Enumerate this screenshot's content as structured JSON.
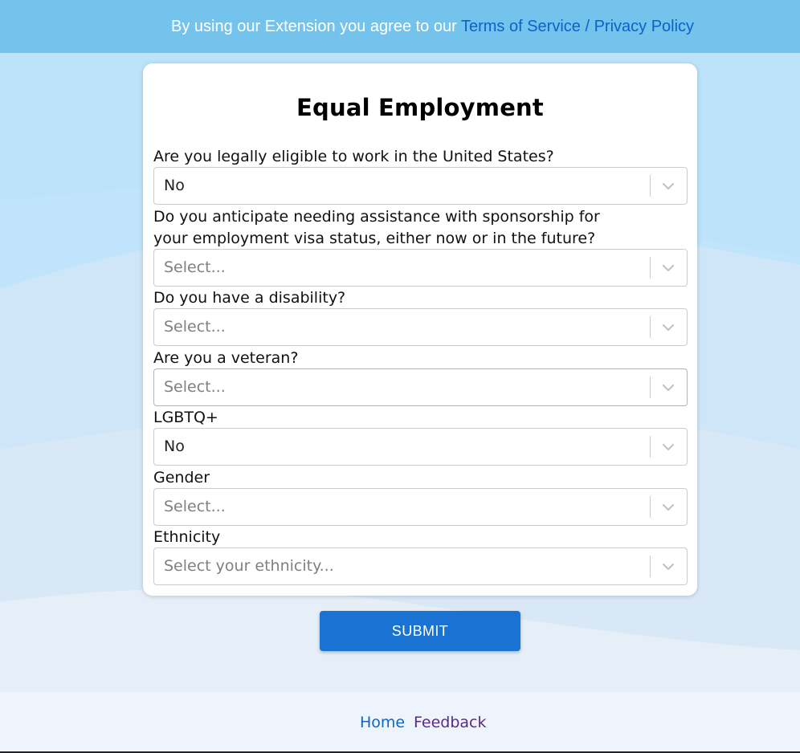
{
  "banner": {
    "text": "By using our Extension you agree to our ",
    "link": "Terms of Service / Privacy Policy"
  },
  "form": {
    "title": "Equal Employment",
    "questions": [
      {
        "label": "Are you legally eligible to work in the United States?",
        "value": "No",
        "is_placeholder": false
      },
      {
        "label": "Do you anticipate needing assistance with sponsorship for your employment visa status, either now or in the future?",
        "value": "Select...",
        "is_placeholder": true
      },
      {
        "label": "Do you have a disability?",
        "value": "Select...",
        "is_placeholder": true
      },
      {
        "label": "Are you a veteran?",
        "value": "Select...",
        "is_placeholder": true
      },
      {
        "label": "LGBTQ+",
        "value": "No",
        "is_placeholder": false
      },
      {
        "label": "Gender",
        "value": "Select...",
        "is_placeholder": true
      },
      {
        "label": "Ethnicity",
        "value": "Select your ethnicity...",
        "is_placeholder": true
      }
    ],
    "submit_label": "SUBMIT"
  },
  "footer": {
    "home": "Home",
    "feedback": "Feedback"
  },
  "colors": {
    "banner": "#74c3ec",
    "link": "#0b63c9",
    "primary_button": "#1a73d2",
    "feedback_link": "#5b2a86"
  }
}
